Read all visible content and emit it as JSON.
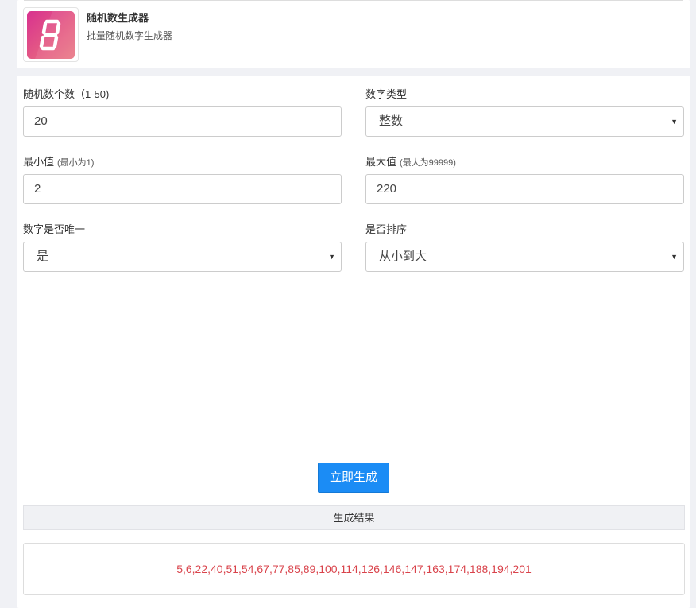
{
  "app": {
    "title": "随机数生成器",
    "description": "批量随机数字生成器",
    "icon": "seven-segment-digit-eight-icon",
    "icon_colors": [
      "#d8318f",
      "#ea7a86"
    ]
  },
  "form": {
    "count": {
      "label": "随机数个数（1-50)",
      "value": "20"
    },
    "type": {
      "label": "数字类型",
      "value": "整数"
    },
    "min": {
      "label": "最小值",
      "hint": "(最小为1)",
      "value": "2"
    },
    "max": {
      "label": "最大值",
      "hint": "(最大为99999)",
      "value": "220"
    },
    "unique": {
      "label": "数字是否唯一",
      "value": "是"
    },
    "sort": {
      "label": "是否排序",
      "value": "从小到大"
    }
  },
  "actions": {
    "generate_label": "立即生成",
    "accent_color": "#1b8cf5"
  },
  "result": {
    "heading": "生成结果",
    "value": "5,6,22,40,51,54,67,77,85,89,100,114,126,146,147,163,174,188,194,201",
    "color": "#d9434b"
  }
}
